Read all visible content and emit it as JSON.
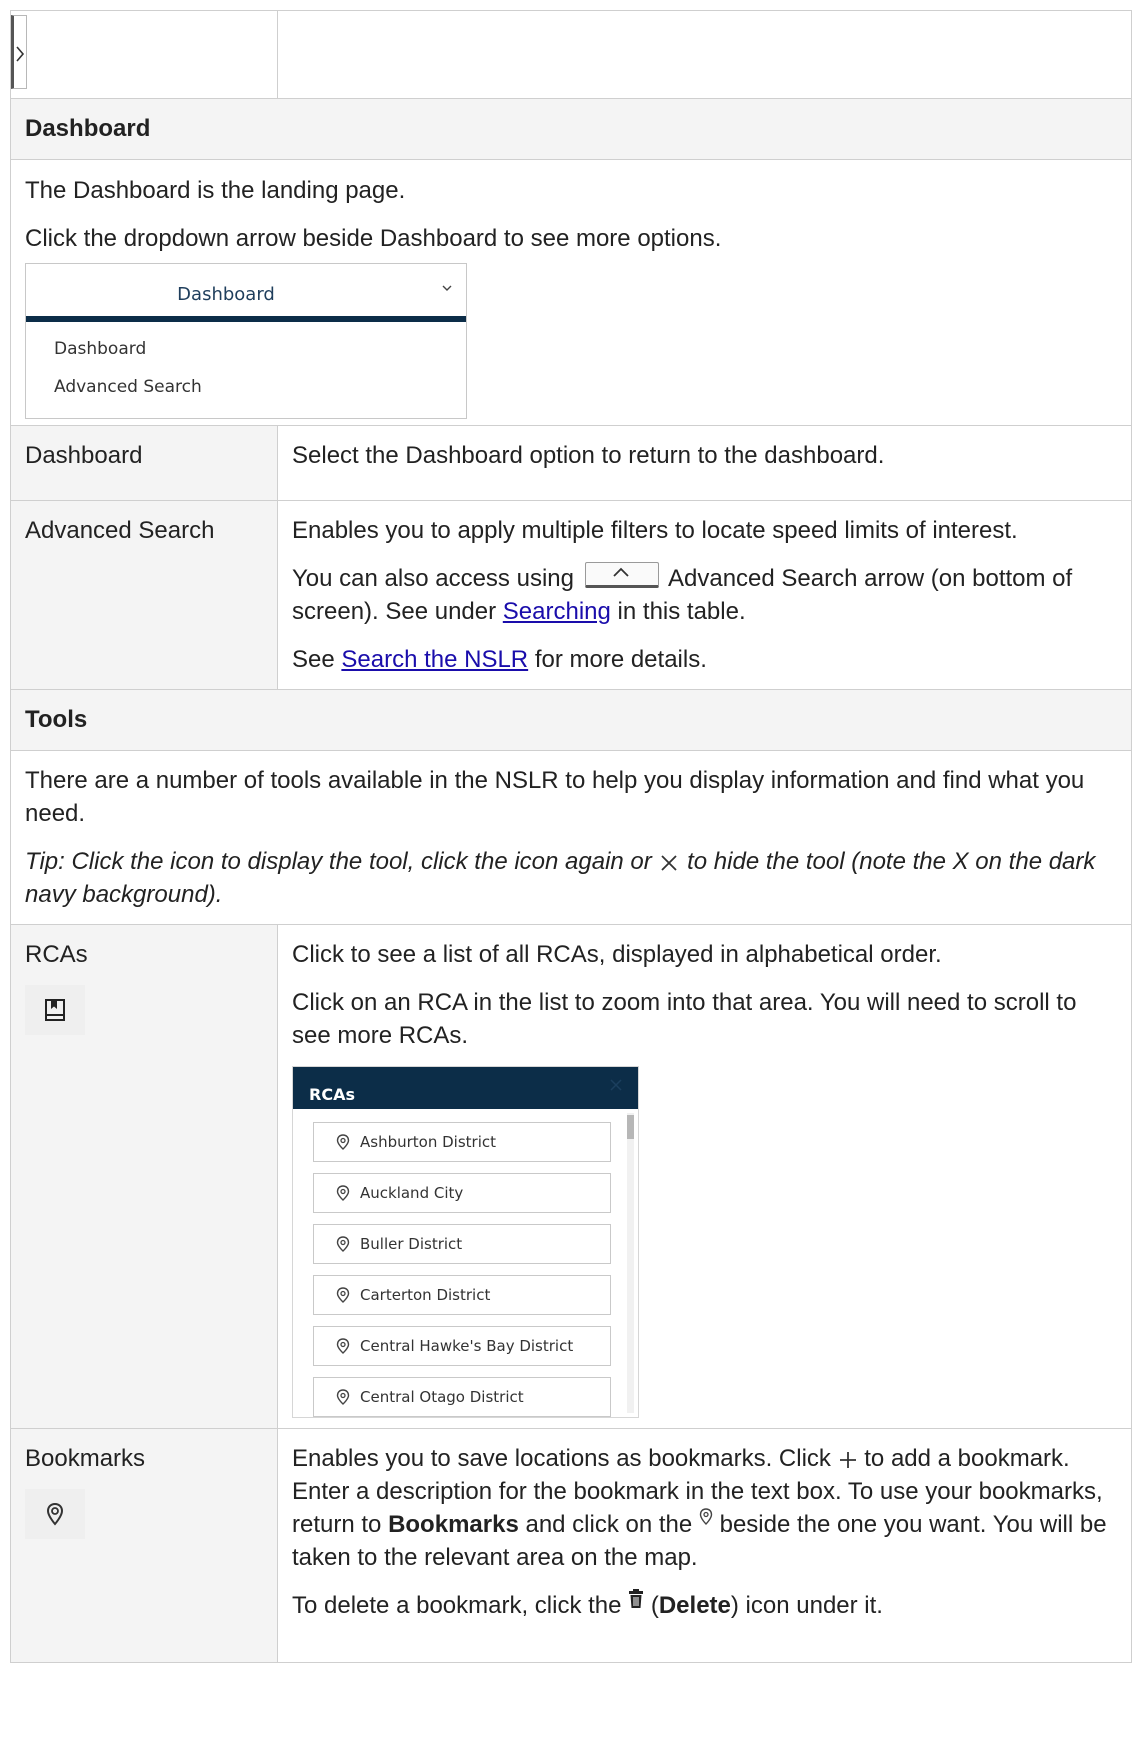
{
  "dashboard": {
    "title": "Dashboard",
    "intro1": "The Dashboard is the landing page.",
    "intro2": "Click the dropdown arrow beside Dashboard to see more options.",
    "dropdown": {
      "selected": "Dashboard",
      "options": [
        "Dashboard",
        "Advanced Search"
      ]
    },
    "rows": [
      {
        "label": "Dashboard",
        "desc": "Select the Dashboard option to return to the dashboard."
      },
      {
        "label": "Advanced Search",
        "desc1": "Enables you to apply multiple filters to locate speed limits of interest.",
        "desc2_a": "You can also access using",
        "desc2_b": "Advanced Search arrow (on bottom of screen). See under",
        "desc2_link": "Searching",
        "desc2_c": "in this table.",
        "desc3_a": "See",
        "desc3_link": "Search the NSLR",
        "desc3_b": "for more details."
      }
    ]
  },
  "tools": {
    "title": "Tools",
    "intro": "There are a number of tools available in the NSLR to help you display information and find what you need.",
    "tip_a": "Tip: Click the icon to display the tool, click the icon again or",
    "tip_b": "to hide the tool (note the X on the dark navy background).",
    "rcas": {
      "label": "RCAs",
      "icon": "book-icon",
      "desc1": "Click to see a list of all RCAs, displayed in alphabetical order.",
      "desc2": "Click on an RCA in the list to zoom into that area. You will need to scroll to see more RCAs.",
      "panel": {
        "title": "RCAs",
        "items": [
          "Ashburton District",
          "Auckland City",
          "Buller District",
          "Carterton District",
          "Central Hawke's Bay District",
          "Central Otago District"
        ]
      }
    },
    "bookmarks": {
      "label": "Bookmarks",
      "icon": "pin-icon",
      "desc_a": "Enables you to save locations as bookmarks. Click",
      "desc_b": "to add a bookmark. Enter a description for the bookmark in the text box. To use your bookmarks, return to",
      "desc_bold": "Bookmarks",
      "desc_c": "and click on the",
      "desc_d": "beside the one you want. You will be taken to the relevant area on the map.",
      "del_a": "To delete a bookmark, click the",
      "del_b": "(",
      "del_bold": "Delete",
      "del_c": ") icon under it."
    }
  },
  "colors": {
    "navy": "#0c2d48",
    "link": "#1a0dab",
    "border": "#cfcfcf",
    "shade": "#f4f4f4"
  }
}
